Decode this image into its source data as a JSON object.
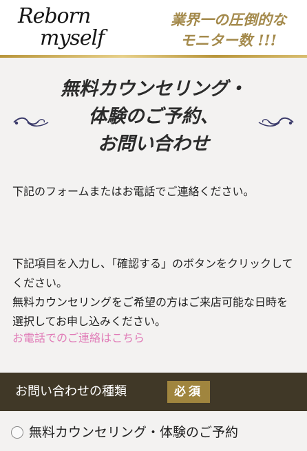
{
  "header": {
    "logo_line1": "Reborn",
    "logo_line2": "myself",
    "tagline_line1": "業界一の圧倒的な",
    "tagline_line2": "モニター数 !!!"
  },
  "title": {
    "line1": "無料カウンセリング・",
    "line2": "体験のご予約、",
    "line3": "お問い合わせ"
  },
  "intro": {
    "paragraph1": "下記のフォームまたはお電話でご連絡ください。",
    "paragraph2": "下記項目を入力し、「確認する」のボタンをクリックしてください。",
    "paragraph3": "無料カウンセリングをご希望の方はご来店可能な日時を選択してお申し込みください。",
    "tel_link": "お電話でのご連絡はこちら"
  },
  "form": {
    "section_label": "お問い合わせの種類",
    "required_label": "必須",
    "options": [
      {
        "label": "無料カウンセリング・体験のご予約",
        "selected": false
      }
    ]
  },
  "colors": {
    "accent_gold": "#a0853e",
    "section_bar": "#403827",
    "link_pink": "#e07bb7",
    "tagline_gold": "#a48a4c"
  }
}
